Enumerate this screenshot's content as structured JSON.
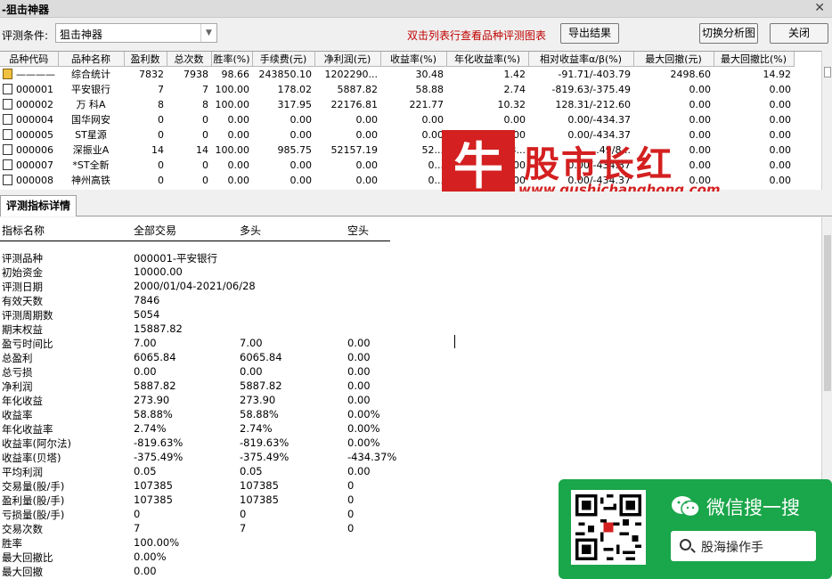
{
  "window": {
    "title": "-狙击神器"
  },
  "toolbar": {
    "cond_label": "评测条件:",
    "cond_value": "狙击神器",
    "hint": "双击列表行查看品种评测图表",
    "export": "导出结果",
    "switch": "切换分析图",
    "close": "关闭"
  },
  "grid": {
    "columns": [
      "品种代码",
      "品种名称",
      "盈利数",
      "总次数",
      "胜率(%)",
      "手续费(元)",
      "净利润(元)",
      "收益率(%)",
      "年化收益率(%)",
      "相对收益率α/β(%)",
      "最大回撤(元)",
      "最大回撤比(%)"
    ],
    "rows": [
      {
        "code": "————",
        "name": "综合统计",
        "win": "7832",
        "total": "7938",
        "rate": "98.66",
        "fee": "243850.10",
        "net": "1202290...",
        "ret": "30.48",
        "annual": "1.42",
        "ab": "-91.71/-403.79",
        "dd": "2498.60",
        "ddr": "14.92"
      },
      {
        "code": "000001",
        "name": "平安银行",
        "win": "7",
        "total": "7",
        "rate": "100.00",
        "fee": "178.02",
        "net": "5887.82",
        "ret": "58.88",
        "annual": "2.74",
        "ab": "-819.63/-375.49",
        "dd": "0.00",
        "ddr": "0.00"
      },
      {
        "code": "000002",
        "name": "万 科A",
        "win": "8",
        "total": "8",
        "rate": "100.00",
        "fee": "317.95",
        "net": "22176.81",
        "ret": "221.77",
        "annual": "10.32",
        "ab": "128.31/-212.60",
        "dd": "0.00",
        "ddr": "0.00"
      },
      {
        "code": "000004",
        "name": "国华网安",
        "win": "0",
        "total": "0",
        "rate": "0.00",
        "fee": "0.00",
        "net": "0.00",
        "ret": "0.00",
        "annual": "0.00",
        "ab": "0.00/-434.37",
        "dd": "0.00",
        "ddr": "0.00"
      },
      {
        "code": "000005",
        "name": "ST星源",
        "win": "0",
        "total": "0",
        "rate": "0.00",
        "fee": "0.00",
        "net": "0.00",
        "ret": "0.00",
        "annual": "0.00",
        "ab": "0.00/-434.37",
        "dd": "0.00",
        "ddr": "0.00"
      },
      {
        "code": "000006",
        "name": "深振业A",
        "win": "14",
        "total": "14",
        "rate": "100.00",
        "fee": "985.75",
        "net": "52157.19",
        "ret": "52...",
        "annual": "24.3...",
        "ab": "...49/8...",
        "dd": "0.00",
        "ddr": "0.00"
      },
      {
        "code": "000007",
        "name": "*ST全新",
        "win": "0",
        "total": "0",
        "rate": "0.00",
        "fee": "0.00",
        "net": "0.00",
        "ret": "0...",
        "annual": "0.00",
        "ab": "0.00/-434.37",
        "dd": "0.00",
        "ddr": "0.00"
      },
      {
        "code": "000008",
        "name": "神州高铁",
        "win": "0",
        "total": "0",
        "rate": "0.00",
        "fee": "0.00",
        "net": "0.00",
        "ret": "0...",
        "annual": "0.00",
        "ab": "0.00/-434.37",
        "dd": "0.00",
        "ddr": "0.00"
      }
    ]
  },
  "detail": {
    "tab": "评测指标详情",
    "headers": {
      "name": "指标名称",
      "all": "全部交易",
      "long": "多头",
      "short": "空头"
    },
    "rows": [
      {
        "k": "评测品种",
        "a": "000001-平安银行",
        "b": "",
        "c": ""
      },
      {
        "k": "初始资金",
        "a": "10000.00",
        "b": "",
        "c": ""
      },
      {
        "k": "评测日期",
        "a": "2000/01/04-2021/06/28",
        "b": "",
        "c": ""
      },
      {
        "k": "有效天数",
        "a": "7846",
        "b": "",
        "c": ""
      },
      {
        "k": "评测周期数",
        "a": "5054",
        "b": "",
        "c": ""
      },
      {
        "k": "期末权益",
        "a": "15887.82",
        "b": "",
        "c": ""
      },
      {
        "k": "盈亏时间比",
        "a": "7.00",
        "b": "7.00",
        "c": "0.00"
      },
      {
        "k": "总盈利",
        "a": "6065.84",
        "b": "6065.84",
        "c": "0.00"
      },
      {
        "k": "总亏损",
        "a": "0.00",
        "b": "0.00",
        "c": "0.00"
      },
      {
        "k": "净利润",
        "a": "5887.82",
        "b": "5887.82",
        "c": "0.00"
      },
      {
        "k": "年化收益",
        "a": "273.90",
        "b": "273.90",
        "c": "0.00"
      },
      {
        "k": "收益率",
        "a": "58.88%",
        "b": "58.88%",
        "c": "0.00%"
      },
      {
        "k": "年化收益率",
        "a": "2.74%",
        "b": "2.74%",
        "c": "0.00%"
      },
      {
        "k": "收益率(阿尔法)",
        "a": "-819.63%",
        "b": "-819.63%",
        "c": "0.00%"
      },
      {
        "k": "收益率(贝塔)",
        "a": "-375.49%",
        "b": "-375.49%",
        "c": "-434.37%"
      },
      {
        "k": "平均利润",
        "a": "0.05",
        "b": "0.05",
        "c": "0.00"
      },
      {
        "k": "交易量(股/手)",
        "a": "107385",
        "b": "107385",
        "c": "0"
      },
      {
        "k": "盈利量(股/手)",
        "a": "107385",
        "b": "107385",
        "c": "0"
      },
      {
        "k": "亏损量(股/手)",
        "a": "0",
        "b": "0",
        "c": "0"
      },
      {
        "k": "交易次数",
        "a": "7",
        "b": "7",
        "c": "0"
      },
      {
        "k": "胜率",
        "a": "100.00%",
        "b": "",
        "c": ""
      },
      {
        "k": "最大回撤比",
        "a": "0.00%",
        "b": "",
        "c": ""
      },
      {
        "k": "最大回撤",
        "a": "0.00",
        "b": "",
        "c": ""
      }
    ]
  },
  "watermark": {
    "logo_char": "牛",
    "brand": "股市长红",
    "url": "www.gushichanghong.com"
  },
  "promo": {
    "title": "微信搜一搜",
    "search": "股海操作手"
  },
  "colors": {
    "hint": "#c00000",
    "brand_red": "#d42020",
    "promo_green": "#1aa64a"
  }
}
